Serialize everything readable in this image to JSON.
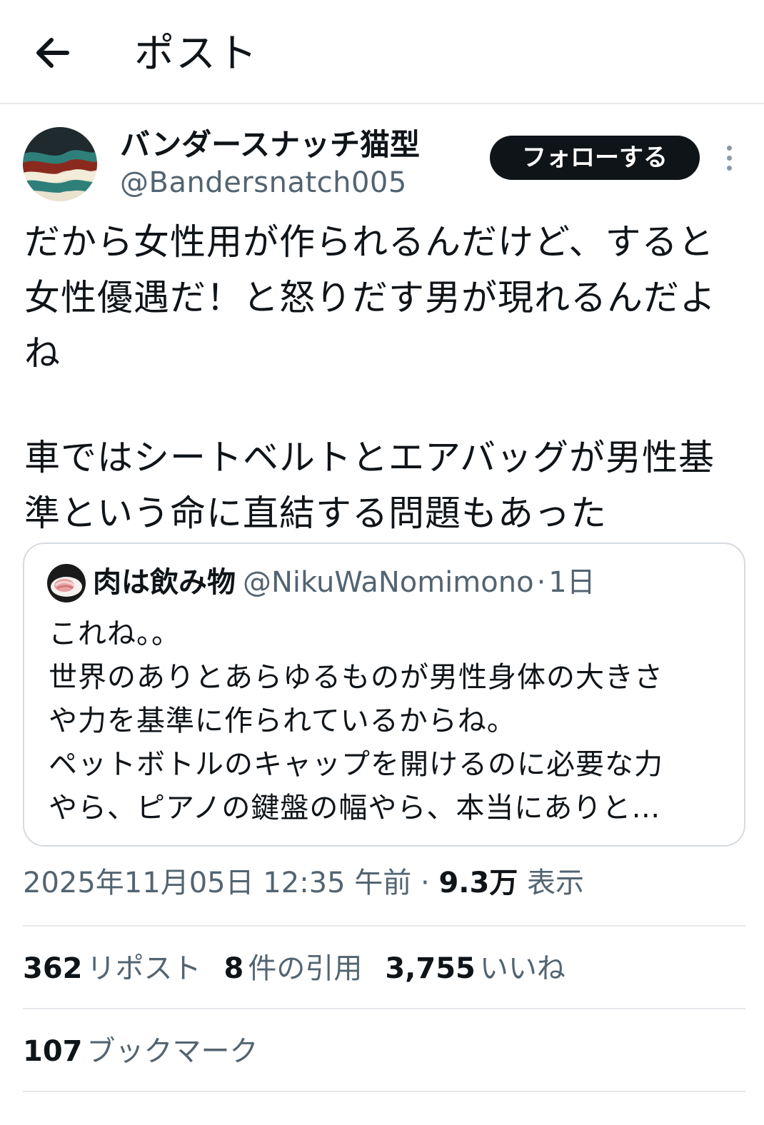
{
  "header": {
    "back_icon": "arrow-left-icon",
    "title": "ポスト"
  },
  "author": {
    "display_name": "バンダースナッチ猫型",
    "handle": "@Bandersnatch005",
    "avatar_icon": "wave-pattern-avatar"
  },
  "follow_button": {
    "label": "フォローする"
  },
  "more_icon": "more-vertical-icon",
  "tweet": {
    "paragraph1": [
      "だから女性用が作られるんだけど、すると",
      "女性優遇だ！と怒りだす男が現れるんだよ",
      "ね"
    ],
    "paragraph2": [
      "車ではシートベルトとエアバッグが男性基",
      "準という命に直結する問題もあった"
    ]
  },
  "quote": {
    "avatar_icon": "meat-avatar",
    "name": "肉は飲み物",
    "handle": "@NikuWaNomimono",
    "separator": "·",
    "time": "1日",
    "lines": [
      "これね。。",
      "世界のありとあらゆるものが男性身体の大きさ",
      "や力を基準に作られているからね。",
      "ペットボトルのキャップを開けるのに必要な力",
      "やら、ピアノの鍵盤の幅やら、本当にありと…"
    ]
  },
  "meta": {
    "timestamp": "2025年11月05日 12:35 午前",
    "separator": "·",
    "views_count": "9.3万",
    "views_label": "表示"
  },
  "stats": {
    "reposts": {
      "count": "362",
      "label": "リポスト"
    },
    "quotes": {
      "count": "8",
      "label": "件の引用"
    },
    "likes": {
      "count": "3,755",
      "label": "いいね"
    }
  },
  "bookmarks": {
    "count": "107",
    "label": "ブックマーク"
  },
  "colors": {
    "text_primary": "#0f1419",
    "text_secondary": "#536471",
    "border": "#e6e9eb",
    "follow_bg": "#0f1419"
  }
}
